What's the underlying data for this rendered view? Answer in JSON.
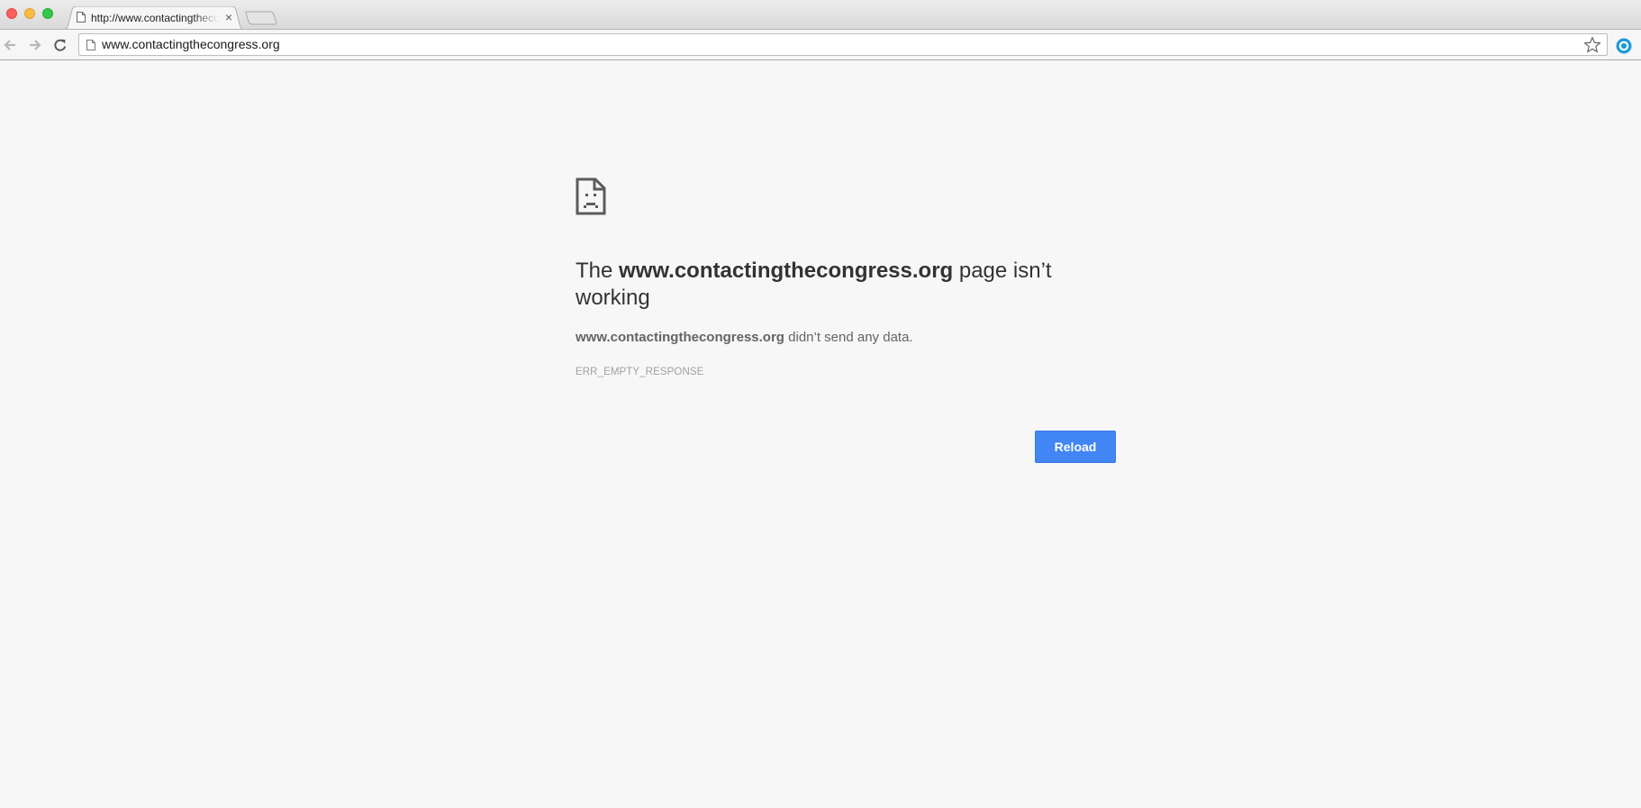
{
  "tab": {
    "title": "http://www.contactingthecongress.org",
    "close_glyph": "×"
  },
  "toolbar": {
    "url": "www.contactingthecongress.org"
  },
  "error": {
    "headline_prefix": "The ",
    "headline_host": "www.contactingthecongress.org",
    "headline_suffix": " page isn’t working",
    "detail_host": "www.contactingthecongress.org",
    "detail_suffix": " didn’t send any data.",
    "code": "ERR_EMPTY_RESPONSE",
    "reload_label": "Reload"
  },
  "colors": {
    "background": "#f7f7f7",
    "button": "#4285f4",
    "extension": "#1e9bd7"
  },
  "icons": {
    "tab": "page-icon",
    "omnibox": "page-icon",
    "bookmark": "star-icon",
    "extension": "circle-extension-icon",
    "error": "sad-page-icon"
  }
}
